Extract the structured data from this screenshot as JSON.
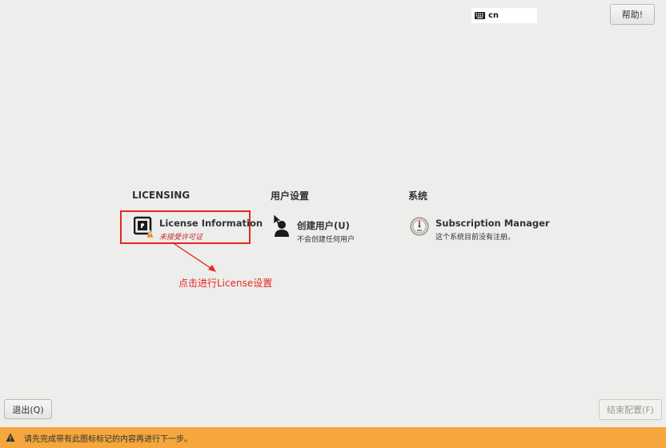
{
  "topbar": {
    "keyboard_layout": "cn",
    "help_label": "帮助!"
  },
  "sections": {
    "licensing": {
      "title": "LICENSING",
      "spoke": {
        "title": "License Information",
        "status": "未接受许可证",
        "icon": "license-warning-icon"
      }
    },
    "user_settings": {
      "title": "用户设置",
      "spoke": {
        "title": "创建用户(U)",
        "status": "不会创建任何用户",
        "icon": "user-icon"
      }
    },
    "system": {
      "title": "系统",
      "spoke": {
        "title": "Subscription Manager",
        "status": "这个系统目前没有注册。",
        "icon": "subscription-gauge-icon"
      }
    }
  },
  "annotation": {
    "text": "点击进行License设置",
    "color": "#e8261f"
  },
  "footer": {
    "quit_label": "退出(Q)",
    "finish_label": "结束配置(F)"
  },
  "warning_bar": {
    "text": "请先完成带有此图标标记的内容再进行下一步。",
    "color": "#f5a63c",
    "icon": "warning-icon"
  }
}
